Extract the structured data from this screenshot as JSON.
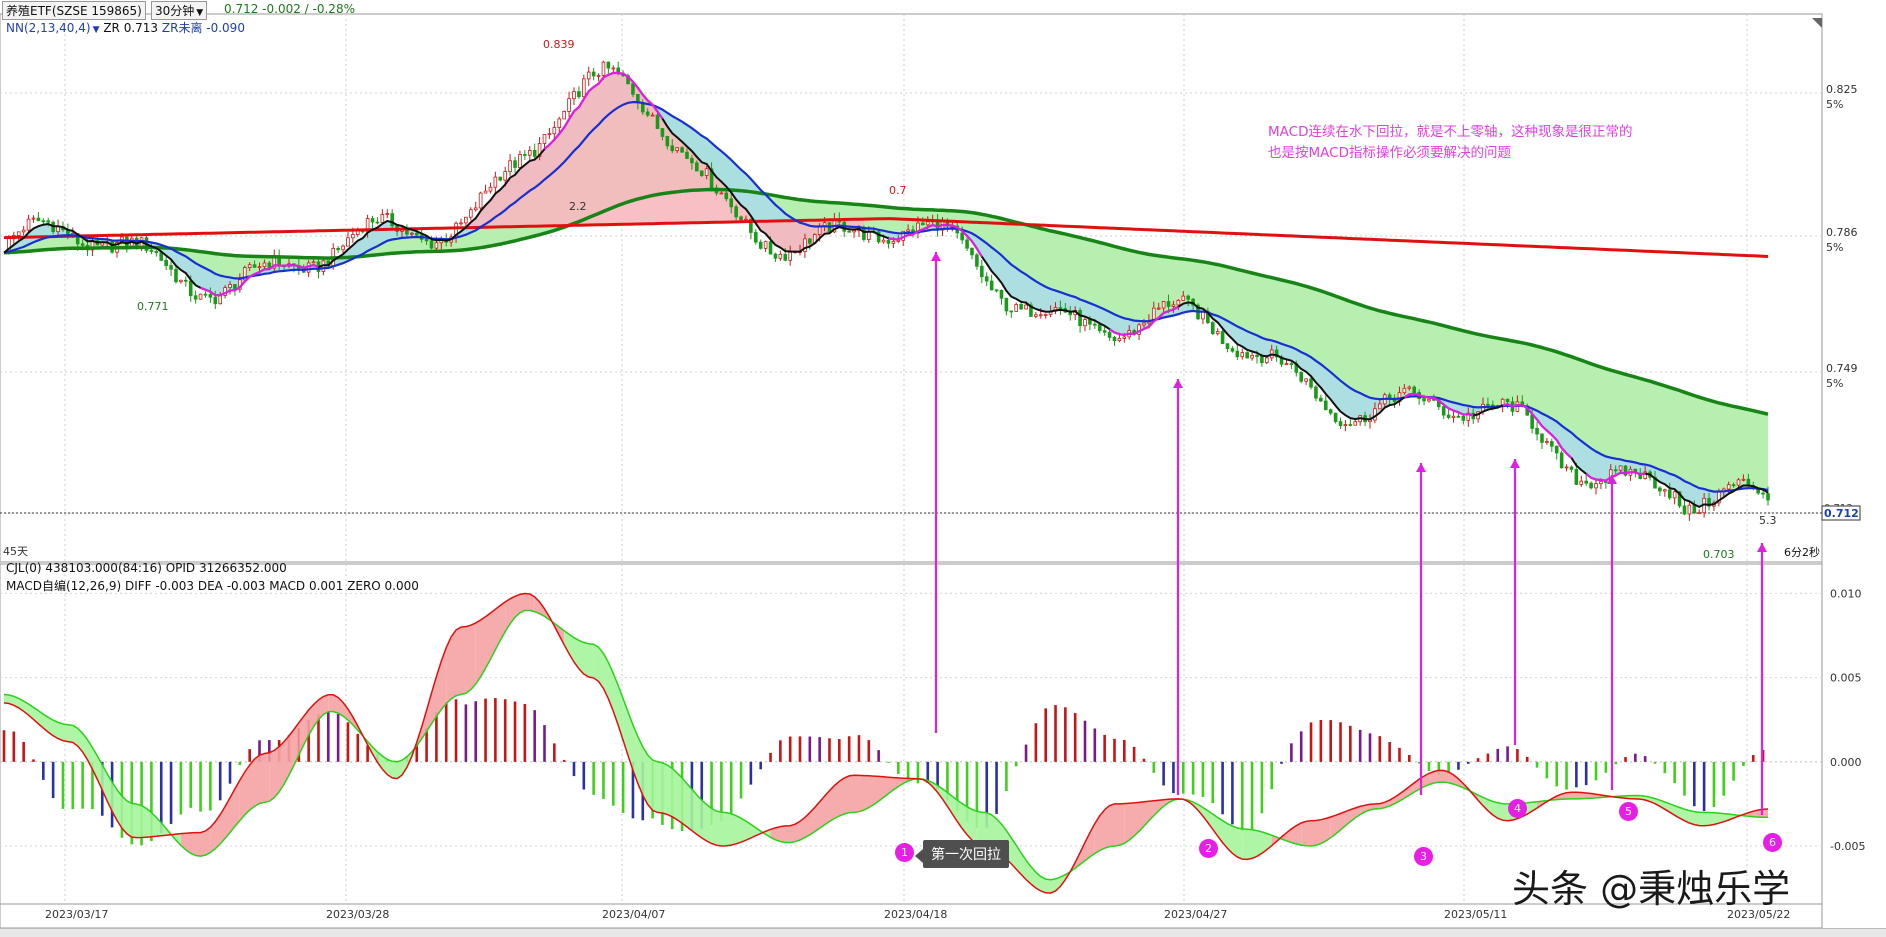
{
  "header": {
    "symbol": "养殖ETF(SZSE 159865)",
    "period": "30分钟",
    "price_readout": "0.712   -0.002 / -0.28%",
    "nn_label": "NN(2,13,40,4)",
    "zr": "ZR 0.713",
    "zr_far": "ZR未离 -0.090"
  },
  "price_panel": {
    "days": "45天",
    "countdown": "6分2秒",
    "y_ticks": [
      "0.825",
      "0.786",
      "0.749",
      "0.712"
    ],
    "pct_ticks": [
      "5%",
      "5%",
      "5%"
    ],
    "last_price": "0.712",
    "last_price_dup": "0.713",
    "labels": {
      "high": "0.839",
      "low1": "0.771",
      "low2": "0.703",
      "mark1": "0.7",
      "mark2": "2.2",
      "mark3": "5.3"
    }
  },
  "cjl_header": "CJL(0)  438103.000(84:16)  OPID 31266352.000",
  "macd_header": "MACD自编(12,26,9)  DIFF -0.003  DEA -0.003  MACD 0.001  ZERO 0.000",
  "macd_ticks": [
    "0.010",
    "0.005",
    "0.000",
    "-0.005"
  ],
  "x_dates": [
    "2023/03/17",
    "2023/03/28",
    "2023/04/07",
    "2023/04/18",
    "2023/04/27",
    "2023/05/11",
    "2023/05/22"
  ],
  "annotation": [
    "MACD连续在水下回拉，就是不上零轴，这种现象是很正常的",
    "也是按MACD指标操作必须要解决的问题"
  ],
  "callout": "第一次回拉",
  "markers": [
    "1",
    "2",
    "3",
    "4",
    "5",
    "6"
  ],
  "watermark": "头条 @秉烛乐学",
  "colors": {
    "up": "#d01818",
    "down": "#1a9a1a",
    "ema_short": "#111111",
    "ema_mid": "#1a2fd0",
    "ema_long": "#188418",
    "ema_base": "#e01010",
    "magenta": "#e020e0",
    "macd_pos": "#c81414",
    "macd_neg_green": "#3fd01a",
    "macd_neg_blue": "#2a30a8"
  },
  "chart_data": [
    {
      "type": "line",
      "title": "",
      "x": [
        "2023/03/17",
        "2023/03/28",
        "2023/04/07",
        "2023/04/18",
        "2023/04/27",
        "2023/05/11",
        "2023/05/22"
      ],
      "series": [
        {
          "values": [
            0.785,
            0.779,
            0.809,
            0.786,
            0.76,
            0.735,
            0.712
          ]
        }
      ],
      "ylim": [
        0.7,
        0.848
      ],
      "grid": true
    },
    {
      "type": "bar",
      "title": "",
      "ylim": [
        -0.0085,
        0.0105
      ],
      "ticks": [
        0.01,
        0.005,
        0.0,
        -0.005
      ],
      "dif": [
        0.0035,
        0.0012,
        -0.0045,
        -0.0042,
        0.0005,
        0.004,
        -0.001,
        0.008,
        0.01,
        0.005,
        -0.003,
        -0.005,
        -0.0038,
        -0.0008,
        -0.001,
        -0.005,
        -0.0078,
        -0.0025,
        -0.0022,
        -0.0058,
        -0.0035,
        -0.0025,
        -0.0005,
        -0.0035,
        -0.0018,
        -0.0022,
        -0.0038,
        -0.0028
      ],
      "dea": [
        0.004,
        0.0022,
        -0.0025,
        -0.0056,
        -0.0024,
        0.003,
        0.0,
        0.004,
        0.009,
        0.007,
        0.0,
        -0.003,
        -0.0048,
        -0.003,
        -0.001,
        -0.003,
        -0.007,
        -0.005,
        -0.0022,
        -0.004,
        -0.005,
        -0.0028,
        -0.0012,
        -0.0025,
        -0.0022,
        -0.002,
        -0.003,
        -0.0033
      ],
      "histogram": [
        0.0025,
        -0.003,
        -0.005,
        -0.0035,
        0.0015,
        0.003,
        0.0,
        0.0045,
        0.0035,
        -0.002,
        -0.0045,
        -0.0038,
        0.0015,
        0.0018,
        -0.0015,
        -0.004,
        0.0035,
        0.0018,
        -0.002,
        -0.0042,
        0.0028,
        0.0018,
        -0.0008,
        0.001,
        -0.002,
        0.0005,
        -0.003,
        0.001
      ]
    }
  ]
}
